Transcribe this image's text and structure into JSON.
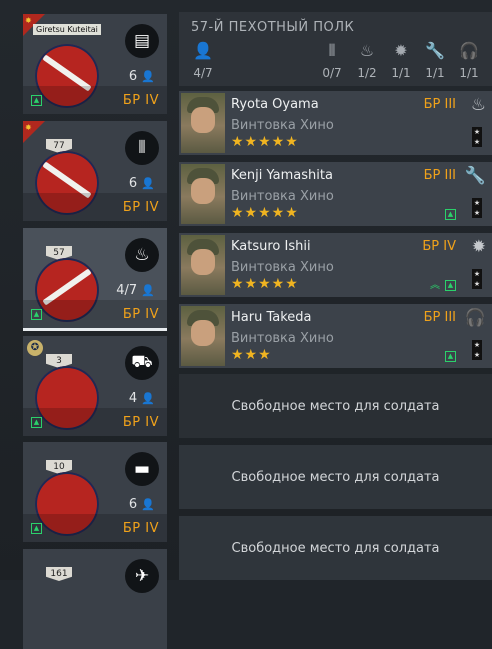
{
  "colors": {
    "br": "#f0a21b",
    "stars": "#f0b421",
    "upgrade": "#2bd16b",
    "emblem": "#b62520"
  },
  "squads": [
    {
      "tag": "Giretsu Kuteitai",
      "type_icon": "document-icon",
      "count": "6",
      "br": "БР IV",
      "upgrade": true
    },
    {
      "level": "77",
      "type_icon": "ammo-icon",
      "count": "6",
      "br": "БР IV",
      "upgrade": false
    },
    {
      "level": "57",
      "type_icon": "flame-icon",
      "count": "4/7",
      "br": "БР IV",
      "upgrade": true,
      "active": true
    },
    {
      "level": "3",
      "type_icon": "truck-icon",
      "count": "4",
      "br": "БР IV",
      "upgrade": true,
      "medal": true
    },
    {
      "level": "10",
      "type_icon": "tank-icon",
      "count": "6",
      "br": "БР IV",
      "upgrade": true
    },
    {
      "level": "161",
      "type_icon": "plane-icon"
    }
  ],
  "unit": {
    "title": "57-Й ПЕХОТНЫЙ ПОЛК",
    "stats": [
      {
        "icon": "soldier-icon",
        "value": "4/7"
      },
      {
        "icon": "ammo-icon",
        "value": "0/7"
      },
      {
        "icon": "flame-icon",
        "value": "1/2"
      },
      {
        "icon": "explosion-icon",
        "value": "1/1"
      },
      {
        "icon": "wrench-icon",
        "value": "1/1"
      },
      {
        "icon": "headphones-icon",
        "value": "1/1"
      }
    ]
  },
  "soldiers": [
    {
      "name": "Ryota Oyama",
      "weapon": "Винтовка Хино",
      "stars": "★★★★★",
      "br": "БР III",
      "role_icon": "flame-icon"
    },
    {
      "name": "Kenji Yamashita",
      "weapon": "Винтовка Хино",
      "stars": "★★★★★",
      "br": "БР III",
      "role_icon": "wrench-icon"
    },
    {
      "name": "Katsuro Ishii",
      "weapon": "Винтовка Хино",
      "stars": "★★★★★",
      "br": "БР IV",
      "role_icon": "explosion-icon"
    },
    {
      "name": "Haru Takeda",
      "weapon": "Винтовка Хино",
      "stars": "★★★",
      "br": "БР III",
      "role_icon": "headphones-icon"
    }
  ],
  "empty_slot": "Свободное место для солдата"
}
